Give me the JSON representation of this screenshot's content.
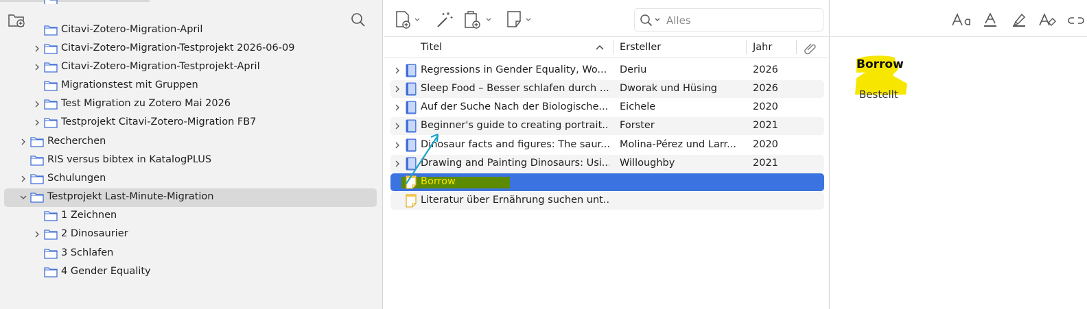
{
  "left": {
    "collections": [
      {
        "label": "Citavi-Zotero-Migration-April",
        "twisty": false
      },
      {
        "label": "Citavi-Zotero-Migration-Testprojekt 2026-06-09",
        "twisty": true
      },
      {
        "label": "Citavi-Zotero-Migration-Testprojekt-April",
        "twisty": true
      },
      {
        "label": "Migrationstest mit Gruppen",
        "twisty": false
      },
      {
        "label": "Test Migration zu Zotero Mai 2026",
        "twisty": true
      },
      {
        "label": "Testprojekt Citavi-Zotero-Migration FB7",
        "twisty": true
      },
      {
        "label": "Recherchen",
        "twisty": true
      },
      {
        "label": "RIS versus bibtex in KatalogPLUS",
        "twisty": false
      },
      {
        "label": "Schulungen",
        "twisty": true
      },
      {
        "label": "Testprojekt Last-Minute-Migration",
        "twisty": true,
        "expanded": true,
        "selected": true
      },
      {
        "label": "1 Zeichnen",
        "twisty": false
      },
      {
        "label": "2 Dinosaurier",
        "twisty": true
      },
      {
        "label": "3 Schlafen",
        "twisty": false
      },
      {
        "label": "4 Gender Equality",
        "twisty": false
      }
    ]
  },
  "middle": {
    "search": {
      "placeholder": "Alles"
    },
    "columns": {
      "title": "Titel",
      "creator": "Ersteller",
      "year": "Jahr"
    },
    "items": [
      {
        "title": "Regressions in Gender Equality, Wo...",
        "creator": "Deriu",
        "year": "2026",
        "kind": "book"
      },
      {
        "title": "Sleep Food – Besser schlafen durch ...",
        "creator": "Dworak und Hüsing",
        "year": "2026",
        "kind": "book"
      },
      {
        "title": "Auf der Suche Nach der Biologische...",
        "creator": "Eichele",
        "year": "2020",
        "kind": "book"
      },
      {
        "title": "Beginner's guide to creating portrait...",
        "creator": "Forster",
        "year": "2021",
        "kind": "book"
      },
      {
        "title": "Dinosaur facts and figures: The saur...",
        "creator": "Molina-Pérez und Larr...",
        "year": "2020",
        "kind": "book"
      },
      {
        "title": "Drawing and Painting Dinosaurs: Usi...",
        "creator": "Willoughby",
        "year": "2021",
        "kind": "book"
      },
      {
        "title": "Borrow",
        "creator": "",
        "year": "",
        "kind": "note",
        "selected": true
      },
      {
        "title": "Literatur über Ernährung suchen unt...",
        "creator": "",
        "year": "",
        "kind": "note"
      }
    ]
  },
  "right": {
    "note_title": "Borrow",
    "note_body": "Bestellt"
  },
  "colors": {
    "accent": "#3b73e0",
    "highlight": "#f6e600",
    "highlight_dark": "#5c8a00",
    "arrow": "#1aa3c8",
    "folder": "#3f6fd8"
  }
}
